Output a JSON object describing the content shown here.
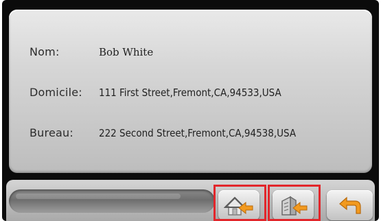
{
  "contact": {
    "name_label": "Nom:",
    "name_value": "Bob White",
    "home_label": "Domicile:",
    "home_value": "111 First Street,Fremont,CA,94533,USA",
    "office_label": "Bureau:",
    "office_value": "222 Second Street,Fremont,CA,94538,USA"
  },
  "toolbar": {
    "buttons": [
      {
        "icon": "navigate-home-icon",
        "highlighted": true
      },
      {
        "icon": "navigate-office-icon",
        "highlighted": true
      },
      {
        "icon": "back-arrow-icon",
        "highlighted": false
      }
    ]
  },
  "colors": {
    "highlight": "#e2262b",
    "arrow": "#f29a1f",
    "panel": "#d6d6d6",
    "frame": "#0b0b0b"
  }
}
